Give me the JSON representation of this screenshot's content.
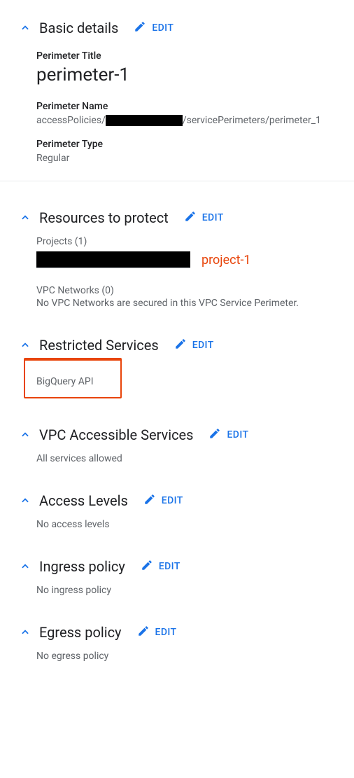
{
  "edit_label": "EDIT",
  "basic": {
    "title": "Basic details",
    "perimeter_title_label": "Perimeter Title",
    "perimeter_title": "perimeter-1",
    "perimeter_name_label": "Perimeter Name",
    "name_prefix": "accessPolicies/",
    "name_suffix": "/servicePerimeters/perimeter_1",
    "perimeter_type_label": "Perimeter Type",
    "perimeter_type": "Regular"
  },
  "resources": {
    "title": "Resources to protect",
    "projects_label": "Projects (1)",
    "project_display": "project-1",
    "vpc_label": "VPC Networks (0)",
    "vpc_msg": "No VPC Networks are secured in this VPC Service Perimeter."
  },
  "restricted": {
    "title": "Restricted Services",
    "item": "BigQuery API"
  },
  "vpc_accessible": {
    "title": "VPC Accessible Services",
    "msg": "All services allowed"
  },
  "access_levels": {
    "title": "Access Levels",
    "msg": "No access levels"
  },
  "ingress": {
    "title": "Ingress policy",
    "msg": "No ingress policy"
  },
  "egress": {
    "title": "Egress policy",
    "msg": "No egress policy"
  }
}
